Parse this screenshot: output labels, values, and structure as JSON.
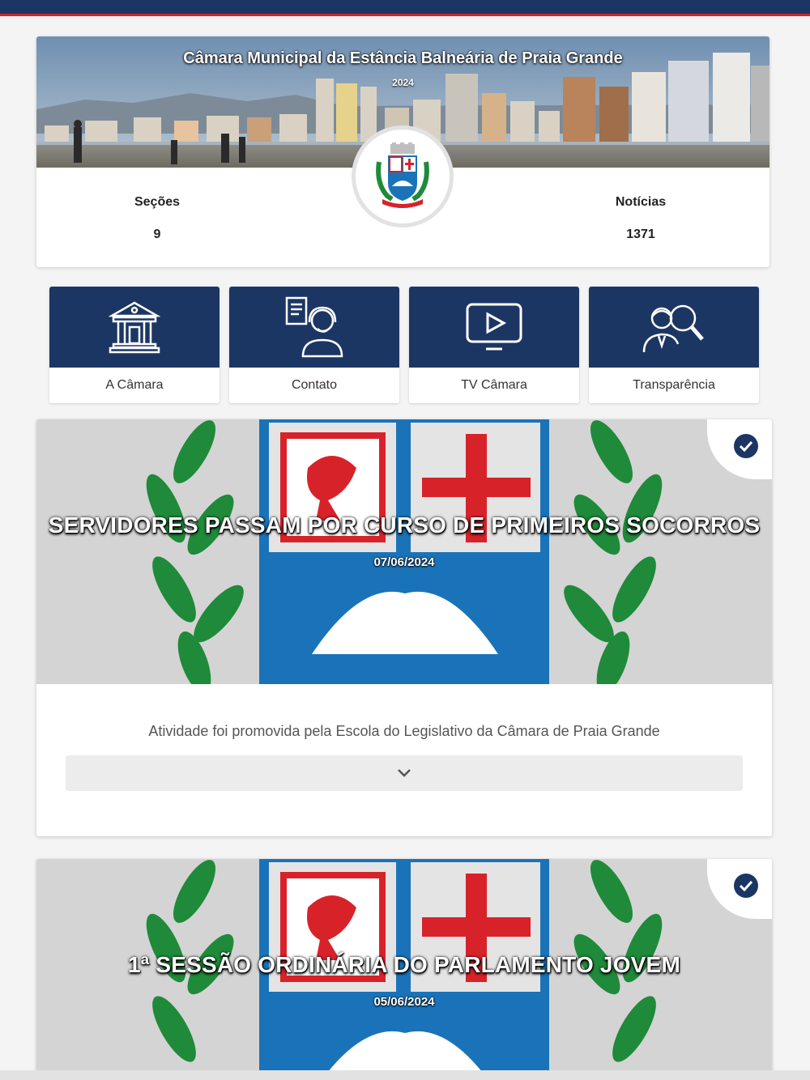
{
  "header": {
    "title": "Câmara Municipal da Estância Balneária de Praia Grande",
    "year": "2024"
  },
  "stats": {
    "sections_label": "Seções",
    "sections_value": "9",
    "news_label": "Notícias",
    "news_value": "1371"
  },
  "tiles": [
    {
      "label": "A Câmara",
      "icon": "building-icon"
    },
    {
      "label": "Contato",
      "icon": "contact-support-icon"
    },
    {
      "label": "TV Câmara",
      "icon": "tv-play-icon"
    },
    {
      "label": "Transparência",
      "icon": "magnifier-person-icon"
    }
  ],
  "news": [
    {
      "title": "SERVIDORES PASSAM POR CURSO DE PRIMEIROS SOCORROS",
      "date": "07/06/2024",
      "summary": "Atividade foi promovida pela Escola do Legislativo da Câmara de Praia Grande"
    },
    {
      "title": "1ª SESSÃO ORDINÁRIA DO PARLAMENTO JOVEM",
      "date": "05/06/2024"
    }
  ],
  "colors": {
    "primary": "#1c3664",
    "accent": "#d8222a",
    "crest_blue": "#1a73b8",
    "crest_green": "#1f8a3a"
  }
}
